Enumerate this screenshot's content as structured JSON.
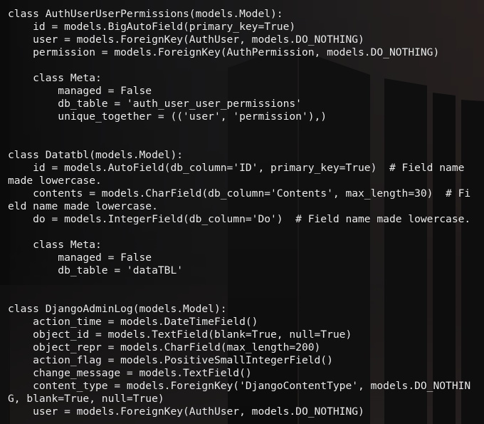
{
  "terminal": {
    "lines": [
      "class AuthUserUserPermissions(models.Model):",
      "    id = models.BigAutoField(primary_key=True)",
      "    user = models.ForeignKey(AuthUser, models.DO_NOTHING)",
      "    permission = models.ForeignKey(AuthPermission, models.DO_NOTHING)",
      "",
      "    class Meta:",
      "        managed = False",
      "        db_table = 'auth_user_user_permissions'",
      "        unique_together = (('user', 'permission'),)",
      "",
      "",
      "class Datatbl(models.Model):",
      "    id = models.AutoField(db_column='ID', primary_key=True)  # Field name",
      "made lowercase.",
      "    contents = models.CharField(db_column='Contents', max_length=30)  # Fi",
      "eld name made lowercase.",
      "    do = models.IntegerField(db_column='Do')  # Field name made lowercase.",
      "",
      "    class Meta:",
      "        managed = False",
      "        db_table = 'dataTBL'",
      "",
      "",
      "class DjangoAdminLog(models.Model):",
      "    action_time = models.DateTimeField()",
      "    object_id = models.TextField(blank=True, null=True)",
      "    object_repr = models.CharField(max_length=200)",
      "    action_flag = models.PositiveSmallIntegerField()",
      "    change_message = models.TextField()",
      "    content_type = models.ForeignKey('DjangoContentType', models.DO_NOTHIN",
      "G, blank=True, null=True)",
      "    user = models.ForeignKey(AuthUser, models.DO_NOTHING)"
    ]
  }
}
